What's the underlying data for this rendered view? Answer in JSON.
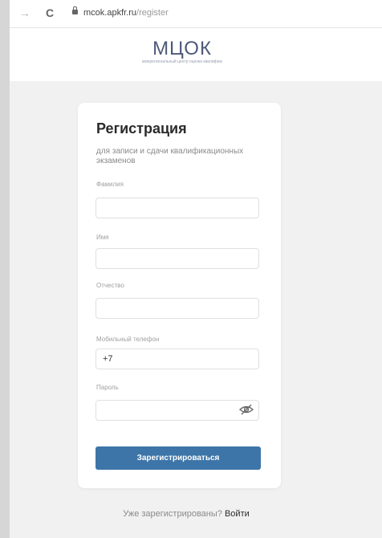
{
  "browser": {
    "back_icon": "arrow-left-icon",
    "forward_glyph": "→",
    "reload_glyph": "C",
    "url_host": "mcok.apkfr.ru",
    "url_path": "/register"
  },
  "logo": {
    "wordmark": "МЦОК",
    "tagline": "межрегиональный центр оценки квалификаций"
  },
  "form": {
    "title": "Регистрация",
    "subtitle": "для записи и сдачи квалификационных экзаменов",
    "fields": [
      {
        "label": "Фамилия",
        "value": ""
      },
      {
        "label": "Имя",
        "value": ""
      },
      {
        "label": "Отчество",
        "value": ""
      },
      {
        "label": "Мобильный телефон",
        "value": "+7"
      },
      {
        "label": "Пароль",
        "value": ""
      }
    ],
    "password_toggle_icon": "eye-slash-icon",
    "submit_label": "Зарегистрироваться"
  },
  "footer": {
    "question": "Уже зарегистрированы?",
    "login_link": "Войти"
  },
  "colors": {
    "primary_button": "#3d75a8",
    "page_background": "#f1f1f1",
    "card_background": "#ffffff"
  }
}
